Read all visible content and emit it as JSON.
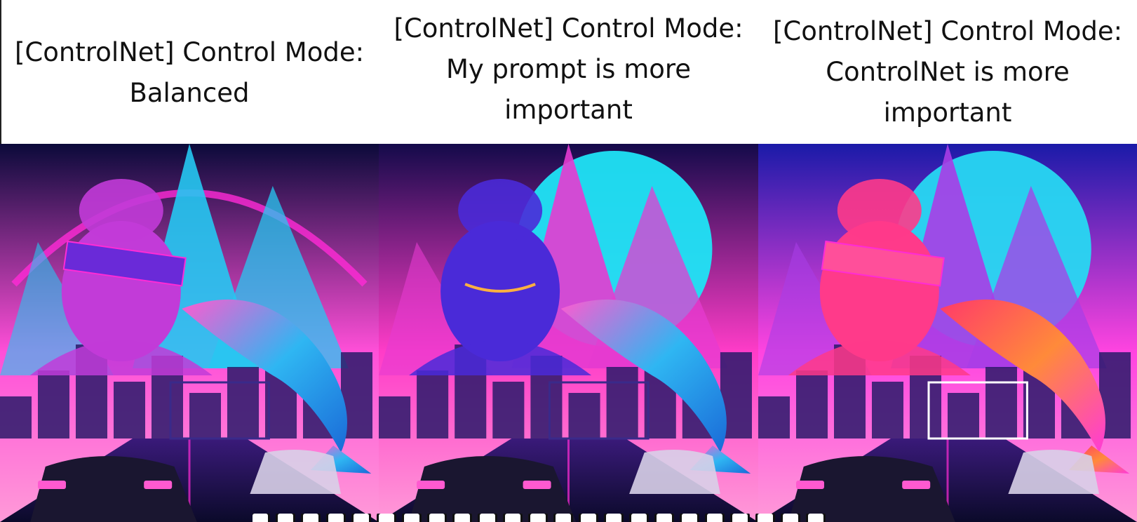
{
  "panels": [
    {
      "caption_lines": [
        "[ControlNet] Control Mode:",
        "Balanced"
      ],
      "scene": {
        "sky_top": "#0b0a3a",
        "sky_bottom": "#ff4fd8",
        "sun": "",
        "mountain": "#25c8f2",
        "accent": "#ff2bd6",
        "statue": "#c23bd8"
      }
    },
    {
      "caption_lines": [
        "[ControlNet] Control Mode:",
        "My prompt is more",
        "important"
      ],
      "scene": {
        "sky_top": "#140a4a",
        "sky_bottom": "#ff3cc8",
        "sun": "#1fe4f5",
        "mountain": "#e63bd0",
        "accent": "#ff2bd6",
        "statue": "#4a2ad8"
      }
    },
    {
      "caption_lines": [
        "[ControlNet] Control Mode:",
        "ControlNet is more",
        "important"
      ],
      "scene": {
        "sky_top": "#1a1aa8",
        "sky_bottom": "#ff44e0",
        "sun": "#27d8f2",
        "mountain": "#a93de6",
        "accent": "#ff3ad8",
        "statue": "#ff3a8a"
      }
    }
  ],
  "colors": {
    "neon_pink": "#ff2bd6",
    "neon_cyan": "#25d6f5",
    "deep_blue": "#0b0a3a",
    "car_dark": "#1a1630",
    "headlight": "#ff5ad0"
  }
}
